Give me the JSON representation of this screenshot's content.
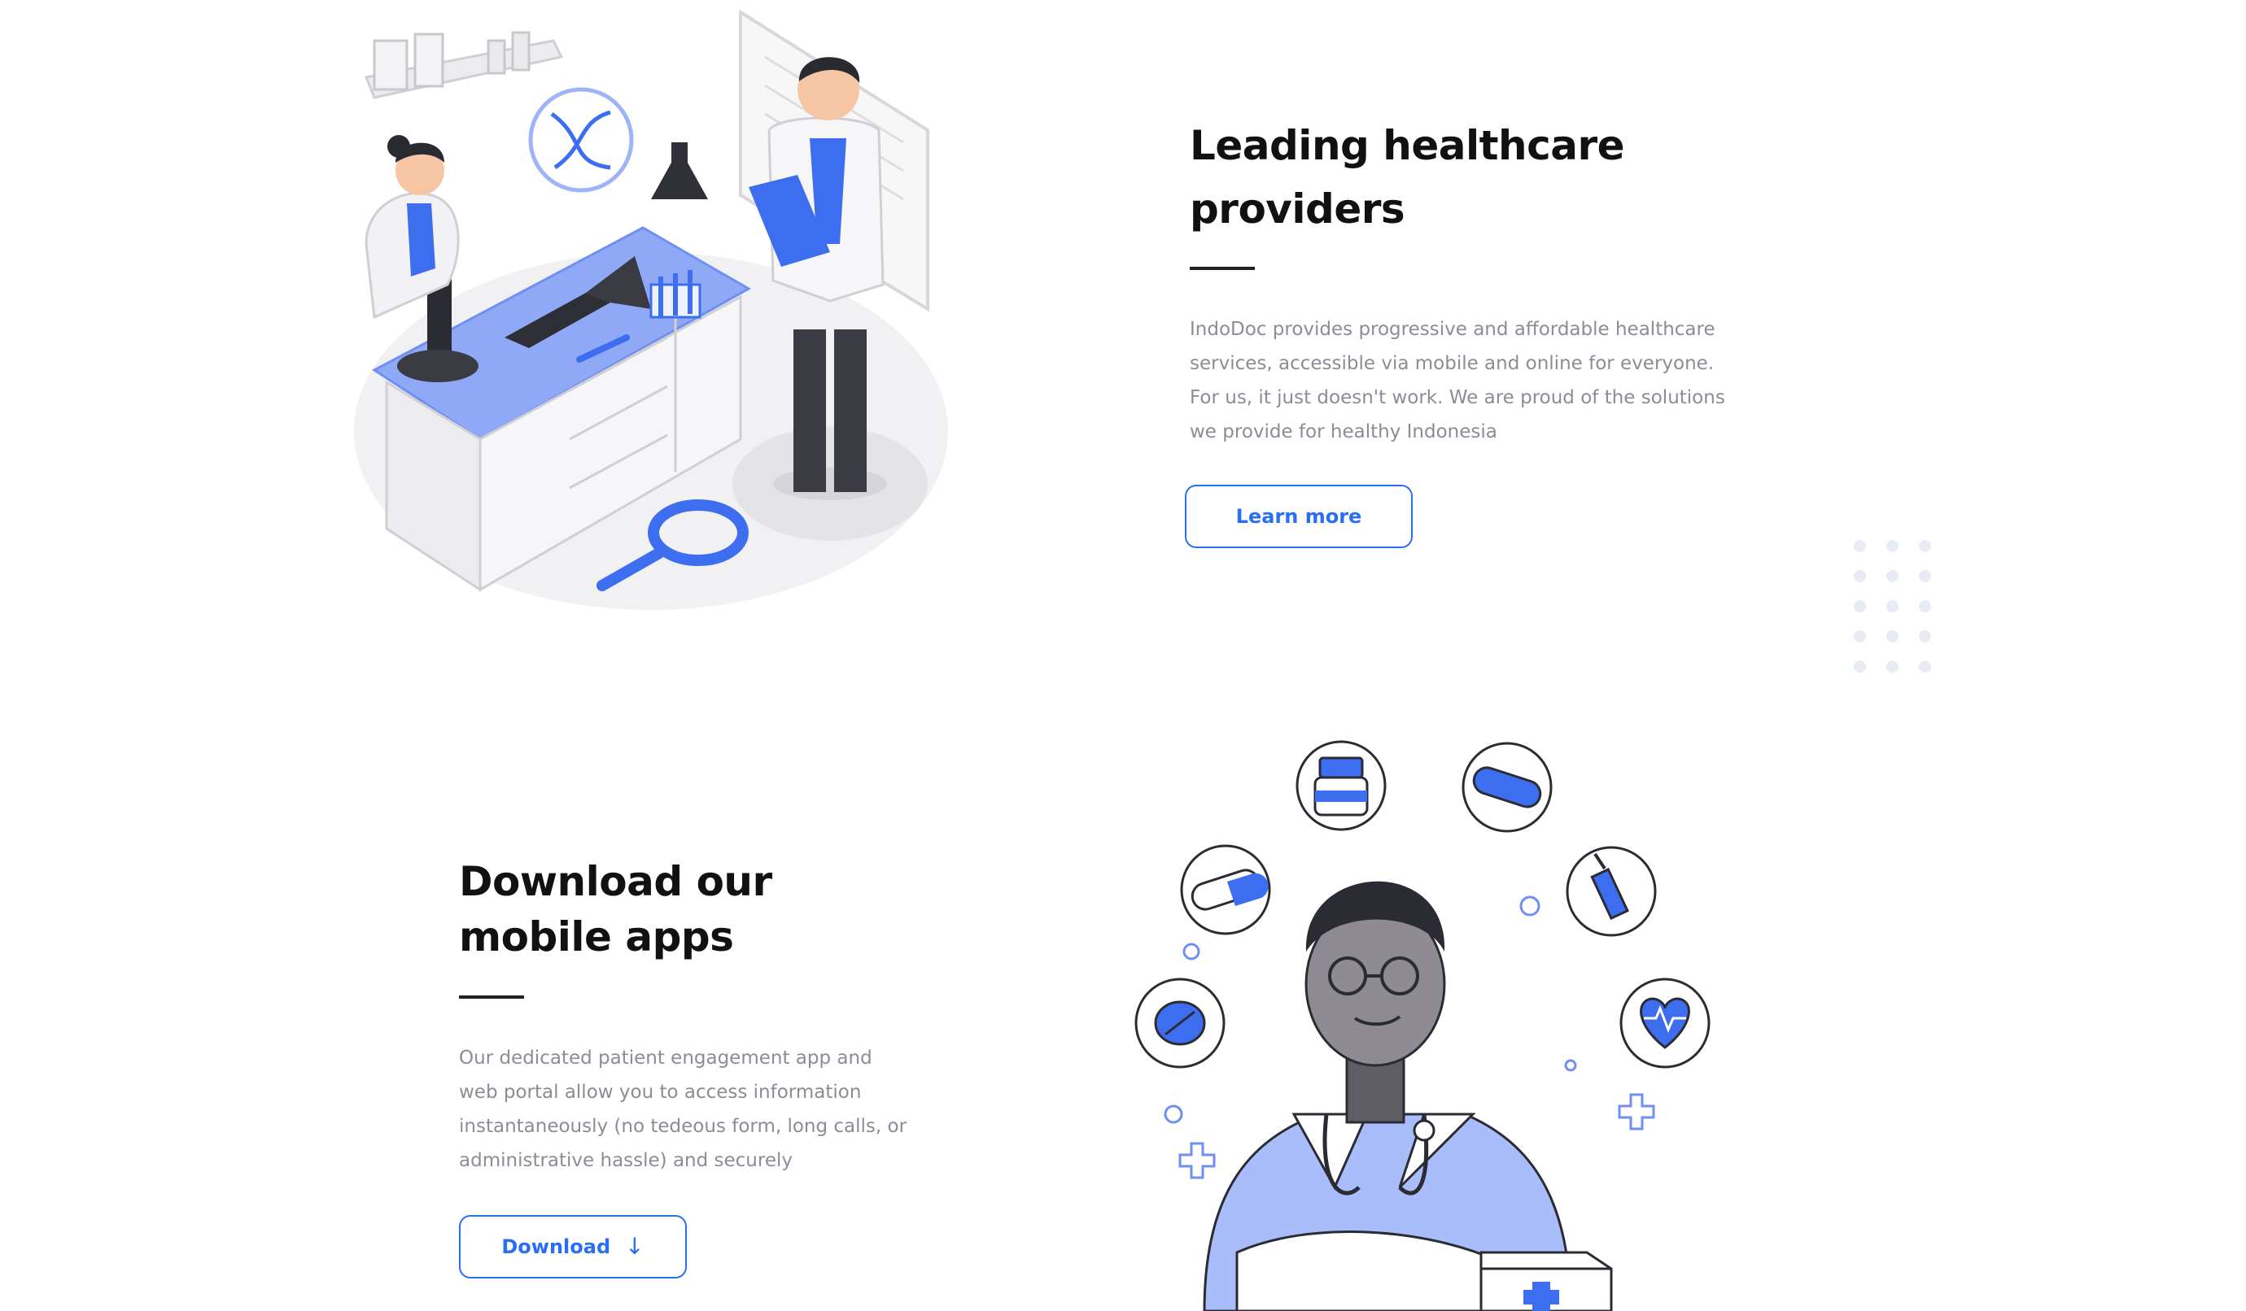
{
  "providers": {
    "heading_line1": "Leading healthcare",
    "heading_line2": "providers",
    "description": "IndoDoc provides progressive and affordable healthcare services, accessible via mobile and online for everyone. For us, it just doesn't work. We are proud of the solutions we provide for healthy Indonesia",
    "button_label": "Learn more"
  },
  "apps": {
    "heading_line1": "Download our",
    "heading_line2": "mobile apps",
    "description": "Our dedicated patient engagement app and web portal allow you to access information instantaneously (no tedeous form, long calls, or administrative hassle) and securely",
    "button_label": "Download",
    "button_icon": "arrow-down-icon"
  },
  "colors": {
    "accent": "#2a6ef5",
    "illustration_blue": "#3d6ef0",
    "illustration_light_blue": "#a9bdfa",
    "text_dark": "#111111",
    "text_muted": "#8a8d96",
    "dots": "#e7ebf4"
  }
}
